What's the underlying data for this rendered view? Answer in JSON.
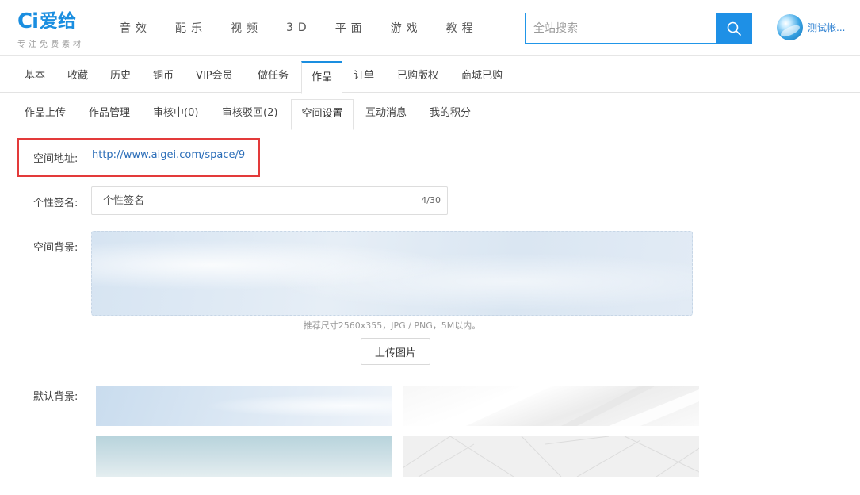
{
  "header": {
    "logo_mark": "Ci",
    "logo_name": "爱给",
    "logo_slogan": "专注免费素材",
    "nav": [
      "音效",
      "配乐",
      "视频",
      "3D",
      "平面",
      "游戏",
      "教程"
    ],
    "search_placeholder": "全站搜索",
    "user_name": "测试帐...",
    "accent_color": "#1a8ee0"
  },
  "tabs_primary": {
    "items": [
      "基本",
      "收藏",
      "历史",
      "铜币",
      "VIP会员",
      "做任务",
      "作品",
      "订单",
      "已购版权",
      "商城已购"
    ],
    "active": "作品"
  },
  "tabs_secondary": {
    "items": [
      "作品上传",
      "作品管理",
      "审核中(0)",
      "审核驳回(2)",
      "空间设置",
      "互动消息",
      "我的积分"
    ],
    "active": "空间设置"
  },
  "form": {
    "space_url_label": "空间地址:",
    "space_url": "http://www.aigei.com/space/9",
    "signature_label": "个性签名:",
    "signature_placeholder": "个性签名",
    "signature_count": "4/30",
    "background_label": "空间背景:",
    "background_hint": "推荐尺寸2560x355，JPG / PNG，5M以内。",
    "upload_label": "上传图片",
    "default_bg_label": "默认背景:"
  }
}
